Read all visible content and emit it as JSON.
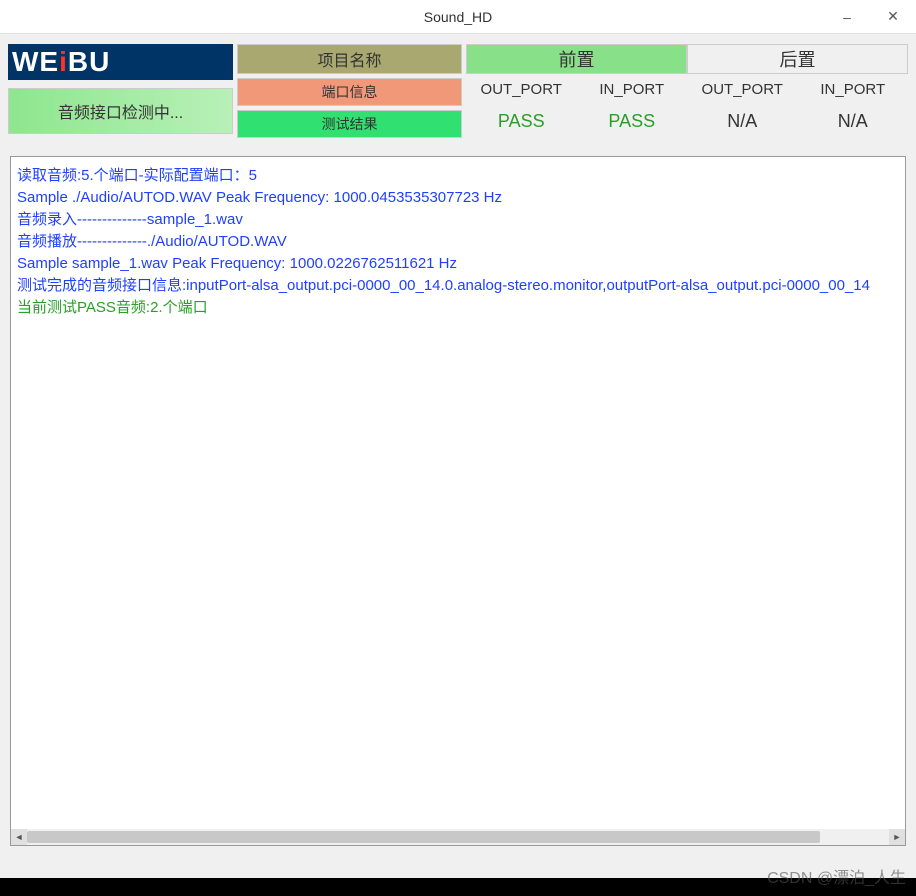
{
  "window": {
    "title": "Sound_HD"
  },
  "logo": {
    "part1": "WE",
    "part2": "i",
    "part3": "BU"
  },
  "status_text": "音频接口检测中...",
  "headers": {
    "project_name": "项目名称",
    "port_info": "端口信息",
    "test_result": "测试结果",
    "front": "前置",
    "back": "后置"
  },
  "ports": {
    "front": {
      "out_label": "OUT_PORT",
      "in_label": "IN_PORT",
      "out_result": "PASS",
      "in_result": "PASS"
    },
    "back": {
      "out_label": "OUT_PORT",
      "in_label": "IN_PORT",
      "out_result": "N/A",
      "in_result": "N/A"
    }
  },
  "log": {
    "lines": [
      {
        "text": "读取音频:5.个端口-实际配置端口：5",
        "class": "log-line"
      },
      {
        "text": "Sample ./Audio/AUTOD.WAV Peak Frequency: 1000.0453535307723 Hz",
        "class": "log-line"
      },
      {
        "text": "音频录入--------------sample_1.wav",
        "class": "log-line"
      },
      {
        "text": "音频播放--------------./Audio/AUTOD.WAV",
        "class": "log-line"
      },
      {
        "text": "Sample sample_1.wav Peak Frequency: 1000.0226762511621 Hz",
        "class": "log-line"
      },
      {
        "text": "测试完成的音频接口信息:inputPort-alsa_output.pci-0000_00_14.0.analog-stereo.monitor,outputPort-alsa_output.pci-0000_00_14",
        "class": "log-line"
      },
      {
        "text": "当前测试PASS音频:2.个端口",
        "class": "log-line green"
      }
    ]
  },
  "watermark": "CSDN @漂泊_人生"
}
